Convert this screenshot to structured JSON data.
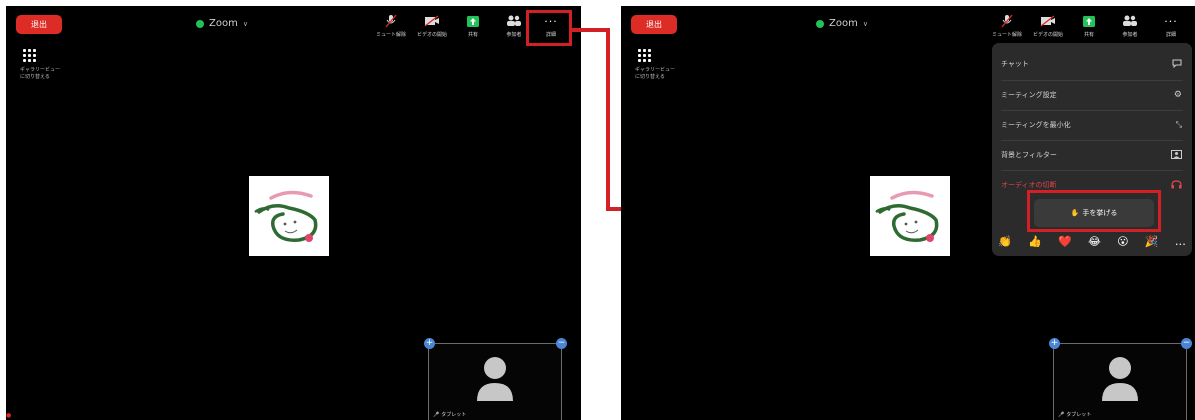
{
  "left": {
    "leave_label": "退出",
    "meeting_title": "Zoom",
    "toolbar": {
      "mute": "ミュート解除",
      "video": "ビデオの開始",
      "share": "共有",
      "participants": "参加者",
      "more": "詳細"
    },
    "gallery_label": "ギャラリービューに切り替える",
    "self_name": "タブレット"
  },
  "right": {
    "leave_label": "退出",
    "meeting_title": "Zoom",
    "toolbar": {
      "mute": "ミュート解除",
      "video": "ビデオの開始",
      "share": "共有",
      "participants": "参加者",
      "more": "詳細"
    },
    "gallery_label": "ギャラリービューに切り替える",
    "self_name": "タブレット",
    "menu": {
      "chat": "チャット",
      "meeting_settings": "ミーティング設定",
      "minimize": "ミーティングを最小化",
      "background": "背景とフィルター",
      "disconnect_audio": "オーディオの切断",
      "raise_hand": "手を挙げる",
      "reactions": [
        "👏",
        "👍",
        "❤️",
        "😂",
        "😮",
        "🎉",
        "…"
      ]
    }
  },
  "colors": {
    "leave_red": "#dd2b26",
    "highlight_red": "#d32027",
    "shield_green": "#23c259",
    "disconnect_text": "#e0454b",
    "pin_blue": "#4a86d3"
  }
}
